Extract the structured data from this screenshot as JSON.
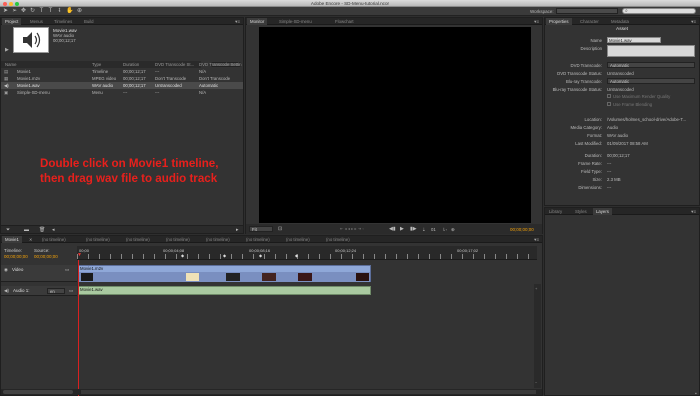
{
  "window": {
    "title": "Adobe Encore - SD-Menu-tutorial.ncor"
  },
  "workspace": {
    "label": "Workspace:",
    "value": ""
  },
  "project_panel": {
    "tabs": [
      "Project",
      "Menus",
      "Timelines",
      "Build"
    ],
    "asset_name": "Movie1.wav",
    "asset_type": "WAV audio",
    "asset_duration": "00;00;12;17",
    "columns": [
      "Name",
      "Type",
      "Duration",
      "DVD Transcode St...",
      "DVD Transcode Settin"
    ],
    "rows": [
      {
        "name": "Movie1",
        "type": "Timeline",
        "duration": "00;00;12;17",
        "dvd_status": "---",
        "dvd_settings": "N/A"
      },
      {
        "name": "Movie1.m2v",
        "type": "MPEG video",
        "duration": "00;00;12;17",
        "dvd_status": "Don't Transcode",
        "dvd_settings": "Don't Transcode"
      },
      {
        "name": "Movie1.wav",
        "type": "WAV audio",
        "duration": "00;00;12;17",
        "dvd_status": "Untranscoded",
        "dvd_settings": "Automatic"
      },
      {
        "name": "Simple-SD-menu",
        "type": "Menu",
        "duration": "---",
        "dvd_status": "---",
        "dvd_settings": "N/A"
      }
    ]
  },
  "monitor_panel": {
    "tabs": [
      "Monitor",
      "Simple-SD-menu",
      "Flowchart"
    ],
    "zoom": "Fit",
    "timecode_left": "00;00;12;17",
    "frame_counter": "01",
    "timecode_right": "00;00;00;00"
  },
  "properties_panel": {
    "tabs": [
      "Properties",
      "Character",
      "Metadata"
    ],
    "header": "Asset",
    "name_label": "Name",
    "name_value": "Movie1.wav",
    "description_label": "Description",
    "dvd_transcode_label": "DVD Transcode:",
    "dvd_transcode_value": "Automatic",
    "dvd_status_label": "DVD Transcode Status:",
    "dvd_status_value": "Untranscoded",
    "bluray_transcode_label": "Blu-ray Transcode:",
    "bluray_transcode_value": "Automatic",
    "bluray_status_label": "Blu-ray Transcode Status:",
    "bluray_status_value": "Untranscoded",
    "max_render_label": "Use Maximum Render Quality",
    "frame_blending_label": "Use Frame Blending",
    "location_label": "Location:",
    "location_value": "/Volumes/holmes_school-drive/Adobe-T...",
    "media_category_label": "Media Category:",
    "media_category_value": "Audio",
    "format_label": "Format:",
    "format_value": "WAV audio",
    "last_modified_label": "Last Modified:",
    "last_modified_value": "01/09/2017 08:58 AM",
    "duration_label": "Duration:",
    "duration_value": "00;00;12;17",
    "frame_rate_label": "Frame Rate:",
    "frame_rate_value": "---",
    "field_type_label": "Field Type:",
    "field_type_value": "---",
    "size_label": "Size:",
    "size_value": "2.3 MB",
    "dimensions_label": "Dimensions:",
    "dimensions_value": "---"
  },
  "library_panel": {
    "tabs": [
      "Library",
      "Styles",
      "Layers"
    ]
  },
  "timeline_panel": {
    "tabs": [
      "Movie1",
      "(no timeline)",
      "(no timeline)",
      "(no timeline)",
      "(no timeline)",
      "(no timeline)",
      "(no timeline)",
      "(no timeline)",
      "(no timeline)"
    ],
    "timeline_label": "Timeline:",
    "source_label": "Source:",
    "timeline_tc": "00;00;00;00",
    "source_tc": "00;00;00;00",
    "ruler_marks": [
      "00;00",
      "00;00;04;08",
      "00;00;08;16",
      "00;00;12;24",
      "00;00;17;02"
    ],
    "video_track_label": "Video",
    "video_clip": "Movie1.m2v",
    "audio_track_label": "Audio 1:",
    "audio_lang": "en",
    "audio_clip": "Movie1.wav"
  },
  "annotation": {
    "line1": "Double click on Movie1 timeline,",
    "line2": "then drag wav file to audio track",
    "color": "#e8201c"
  }
}
